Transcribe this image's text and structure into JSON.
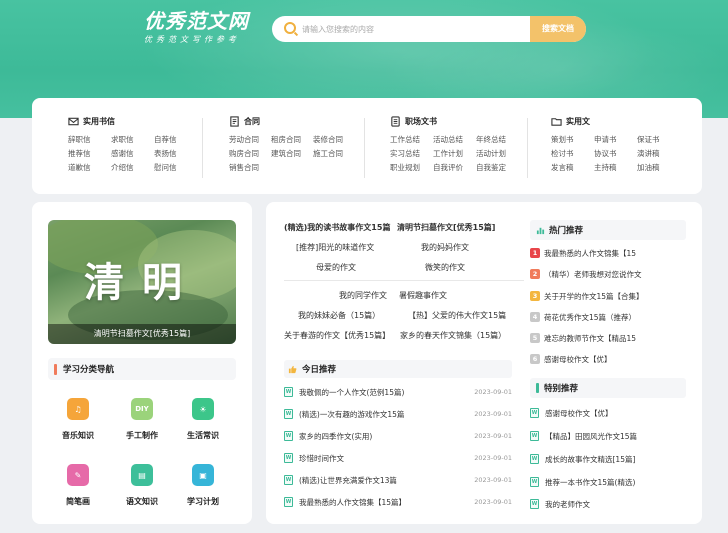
{
  "header": {
    "logo_main": "优秀范文网",
    "logo_sub": "优秀范文写作参考",
    "search_placeholder": "请输入您搜索的内容",
    "search_button": "搜索文档",
    "accent": "#3dba98",
    "button_color": "#f3c26a"
  },
  "categories": [
    {
      "icon": "mail-icon",
      "title": "实用书信",
      "links": [
        "辞职信",
        "求职信",
        "自荐信",
        "推荐信",
        "感谢信",
        "表扬信",
        "道歉信",
        "介绍信",
        "慰问信"
      ]
    },
    {
      "icon": "contract-icon",
      "title": "合同",
      "links": [
        "劳动合同",
        "租房合同",
        "装修合同",
        "购房合同",
        "建筑合同",
        "施工合同",
        "销售合同"
      ]
    },
    {
      "icon": "document-icon",
      "title": "职场文书",
      "links": [
        "工作总结",
        "活动总结",
        "年终总结",
        "实习总结",
        "工作计划",
        "活动计划",
        "职业规划",
        "自我评价",
        "自我鉴定"
      ]
    },
    {
      "icon": "folder-icon",
      "title": "实用文",
      "links": [
        "策划书",
        "申请书",
        "保证书",
        "检讨书",
        "协议书",
        "演讲稿",
        "发言稿",
        "主持稿",
        "加油稿"
      ]
    }
  ],
  "feature": {
    "title": "清明",
    "caption": "清明节扫墓作文[优秀15篇]"
  },
  "study_nav": {
    "title": "学习分类导航",
    "items": [
      {
        "label": "音乐知识",
        "icon": "music-icon",
        "glyph": "♫",
        "color": "#f5a53a"
      },
      {
        "label": "手工制作",
        "icon": "diy-icon",
        "glyph": "DIY",
        "color": "#9bd37b"
      },
      {
        "label": "生活常识",
        "icon": "sun-icon",
        "glyph": "☀",
        "color": "#3cc68a"
      },
      {
        "label": "简笔画",
        "icon": "palette-icon",
        "glyph": "✎",
        "color": "#e66aa8"
      },
      {
        "label": "语文知识",
        "icon": "book-icon",
        "glyph": "▤",
        "color": "#3dbf9a"
      },
      {
        "label": "学习计划",
        "icon": "briefcase-icon",
        "glyph": "▣",
        "color": "#36b5d8"
      }
    ]
  },
  "middle": {
    "links": [
      "(精选)我的读书故事作文15篇",
      "清明节扫墓作文[优秀15篇]",
      "[推荐]阳光的味道作文",
      "我的妈妈作文",
      "母爱的作文",
      "微笑的作文",
      "我的同学作文",
      "暑假趣事作文",
      "我的妹妹必备（15篇）",
      "【热】父爱的伟大作文15篇",
      "关于春游的作文【优秀15篇】",
      "家乡的春天作文锦集（15篇）"
    ],
    "today": {
      "title": "今日推荐",
      "items": [
        {
          "title": "我敬佩的一个人作文(范例15篇)",
          "date": "2023-09-01"
        },
        {
          "title": "(精选)一次有趣的游戏作文15篇",
          "date": "2023-09-01"
        },
        {
          "title": "家乡的四季作文(实用)",
          "date": "2023-09-01"
        },
        {
          "title": "珍惜时间作文",
          "date": "2023-09-01"
        },
        {
          "title": "(精选)让世界充满爱作文13篇",
          "date": "2023-09-01"
        },
        {
          "title": "我最熟悉的人作文锦集【15篇】",
          "date": "2023-09-01"
        }
      ]
    }
  },
  "hot": {
    "title": "热门推荐",
    "items": [
      {
        "num": "1",
        "title": "我最熟悉的人作文锦集【15",
        "color": "#e8454a"
      },
      {
        "num": "2",
        "title": "（精华）老师我想对您说作文",
        "color": "#f07b5b"
      },
      {
        "num": "3",
        "title": "关于开学的作文15篇【合集】",
        "color": "#f3b63f"
      },
      {
        "num": "4",
        "title": "荷花优秀作文15篇（推荐）",
        "color": "#c8c8c8"
      },
      {
        "num": "5",
        "title": "难忘的教师节作文【精品15",
        "color": "#c8c8c8"
      },
      {
        "num": "6",
        "title": "感谢母校作文【优】",
        "color": "#c8c8c8"
      }
    ]
  },
  "special": {
    "title": "特别推荐",
    "items": [
      "感谢母校作文【优】",
      "【精品】田园风光作文15篇",
      "成长的故事作文精选[15篇]",
      "推荐一本书作文15篇(精选)",
      "我的老师作文"
    ]
  }
}
